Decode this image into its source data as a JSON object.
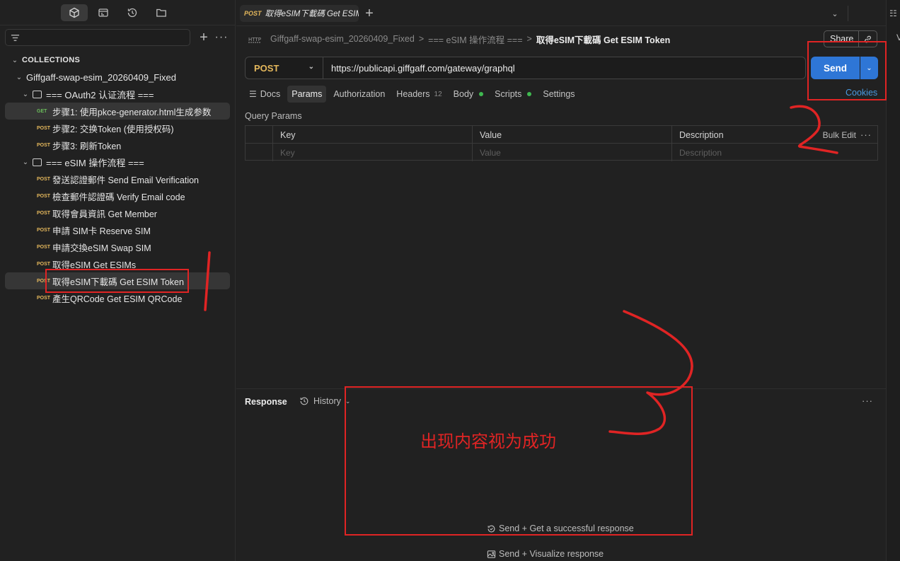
{
  "sidebar": {
    "section_title": "COLLECTIONS",
    "collection_name": "Giffgaff-swap-esim_20260409_Fixed",
    "folders": [
      {
        "name": "=== OAuth2 认证流程 ===",
        "requests": [
          {
            "method": "GET",
            "name": "步骤1: 使用pkce-generator.html生成参数"
          },
          {
            "method": "POST",
            "name": "步骤2: 交换Token (使用授权码)"
          },
          {
            "method": "POST",
            "name": "步骤3: 刷新Token"
          }
        ]
      },
      {
        "name": "=== eSIM 操作流程 ===",
        "requests": [
          {
            "method": "POST",
            "name": "發送認證郵件 Send Email Verification"
          },
          {
            "method": "POST",
            "name": "檢查郵件認證碼 Verify Email code"
          },
          {
            "method": "POST",
            "name": "取得會員資訊 Get Member"
          },
          {
            "method": "POST",
            "name": "申請 SIM卡 Reserve SIM"
          },
          {
            "method": "POST",
            "name": "申請交換eSIM Swap SIM"
          },
          {
            "method": "POST",
            "name": "取得eSIM Get ESIMs"
          },
          {
            "method": "POST",
            "name": "取得eSIM下載碼 Get ESIM Token"
          },
          {
            "method": "POST",
            "name": "產生QRCode Get ESIM QRCode"
          }
        ]
      }
    ]
  },
  "tab": {
    "method": "POST",
    "title": "取得eSIM下載碼 Get ESIM Token"
  },
  "breadcrumb": {
    "collection": "Giffgaff-swap-esim_20260409_Fixed",
    "separator": ">",
    "folder": "=== eSIM 操作流程 ===",
    "current": "取得eSIM下載碼 Get ESIM Token"
  },
  "request": {
    "method": "POST",
    "url": "https://publicapi.giffgaff.com/gateway/graphql",
    "send_label": "Send",
    "share_label": "Share",
    "cookies_label": "Cookies",
    "tabs": [
      {
        "label": "Docs"
      },
      {
        "label": "Params"
      },
      {
        "label": "Authorization"
      },
      {
        "label": "Headers",
        "count": "12"
      },
      {
        "label": "Body"
      },
      {
        "label": "Scripts"
      },
      {
        "label": "Settings"
      }
    ]
  },
  "params": {
    "title": "Query Params",
    "columns": [
      "Key",
      "Value",
      "Description"
    ],
    "placeholders": [
      "Key",
      "Value",
      "Description"
    ],
    "bulk_edit": "Bulk Edit"
  },
  "response": {
    "title": "Response",
    "history_label": "History",
    "hint_primary": "Send + Get a successful response",
    "hint_secondary": "Send + Visualize response"
  },
  "annotations": {
    "success_note": "出现内容视为成功",
    "color": "#e02424"
  },
  "colors": {
    "accent": "#2e76d6",
    "post": "#e5b85c",
    "get": "#6bbd5b",
    "status_dot": "#3fb950",
    "link": "#4a9ae0"
  }
}
